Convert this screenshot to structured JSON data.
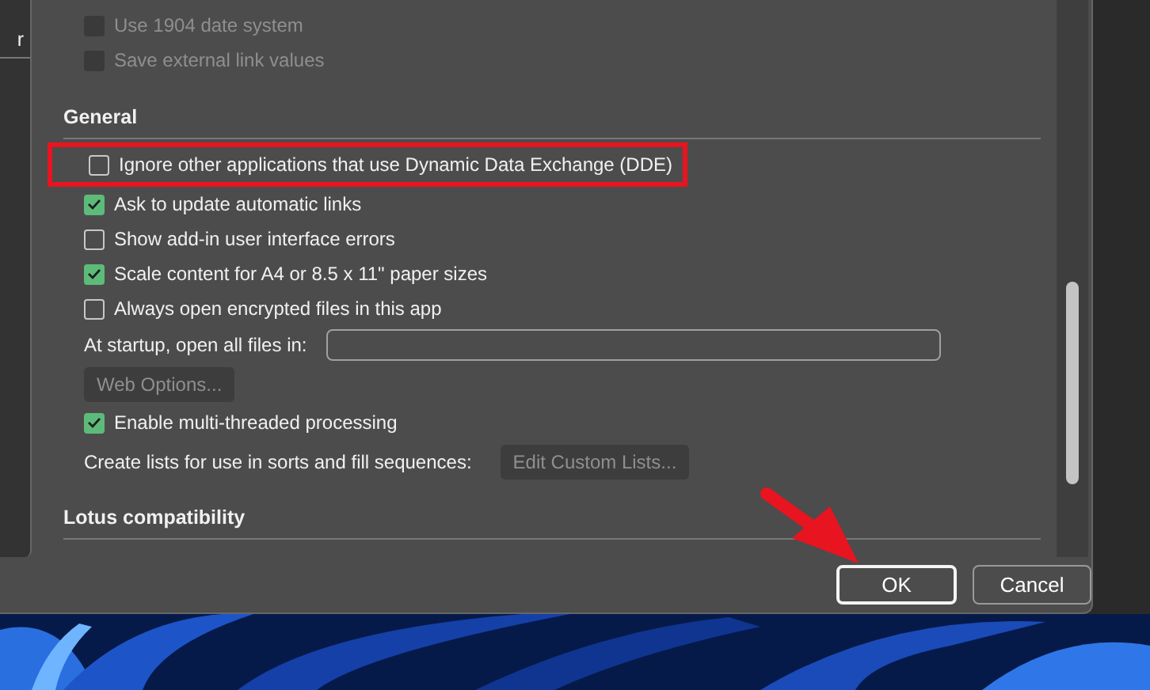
{
  "sidebar": {
    "item": "r"
  },
  "top_options": [
    {
      "label": "Use 1904 date system",
      "checked": false,
      "disabled": true
    },
    {
      "label": "Save external link values",
      "checked": false,
      "disabled": true
    }
  ],
  "sections": [
    {
      "title": "General",
      "items": [
        {
          "kind": "checkbox",
          "label": "Ignore other applications that use Dynamic Data Exchange (DDE)",
          "checked": false,
          "highlighted": true
        },
        {
          "kind": "checkbox",
          "label": "Ask to update automatic links",
          "checked": true,
          "highlighted": false
        },
        {
          "kind": "checkbox",
          "label": "Show add-in user interface errors",
          "checked": false,
          "highlighted": false
        },
        {
          "kind": "checkbox",
          "label": "Scale content for A4 or 8.5 x 11\" paper sizes",
          "checked": true,
          "highlighted": false
        },
        {
          "kind": "checkbox",
          "label": "Always open encrypted files in this app",
          "checked": false,
          "highlighted": false
        },
        {
          "kind": "field",
          "label": "At startup, open all files in:"
        },
        {
          "kind": "button",
          "label": "Web Options...",
          "disabled": true
        },
        {
          "kind": "checkbox",
          "label": "Enable multi-threaded processing",
          "checked": true,
          "highlighted": false
        },
        {
          "kind": "button_row",
          "label": "Create lists for use in sorts and fill sequences:",
          "button": "Edit Custom Lists...",
          "disabled": true
        }
      ]
    },
    {
      "title": "Lotus compatibility"
    }
  ],
  "buttons": [
    {
      "label": "OK",
      "default": true
    },
    {
      "label": "Cancel",
      "default": false
    }
  ]
}
